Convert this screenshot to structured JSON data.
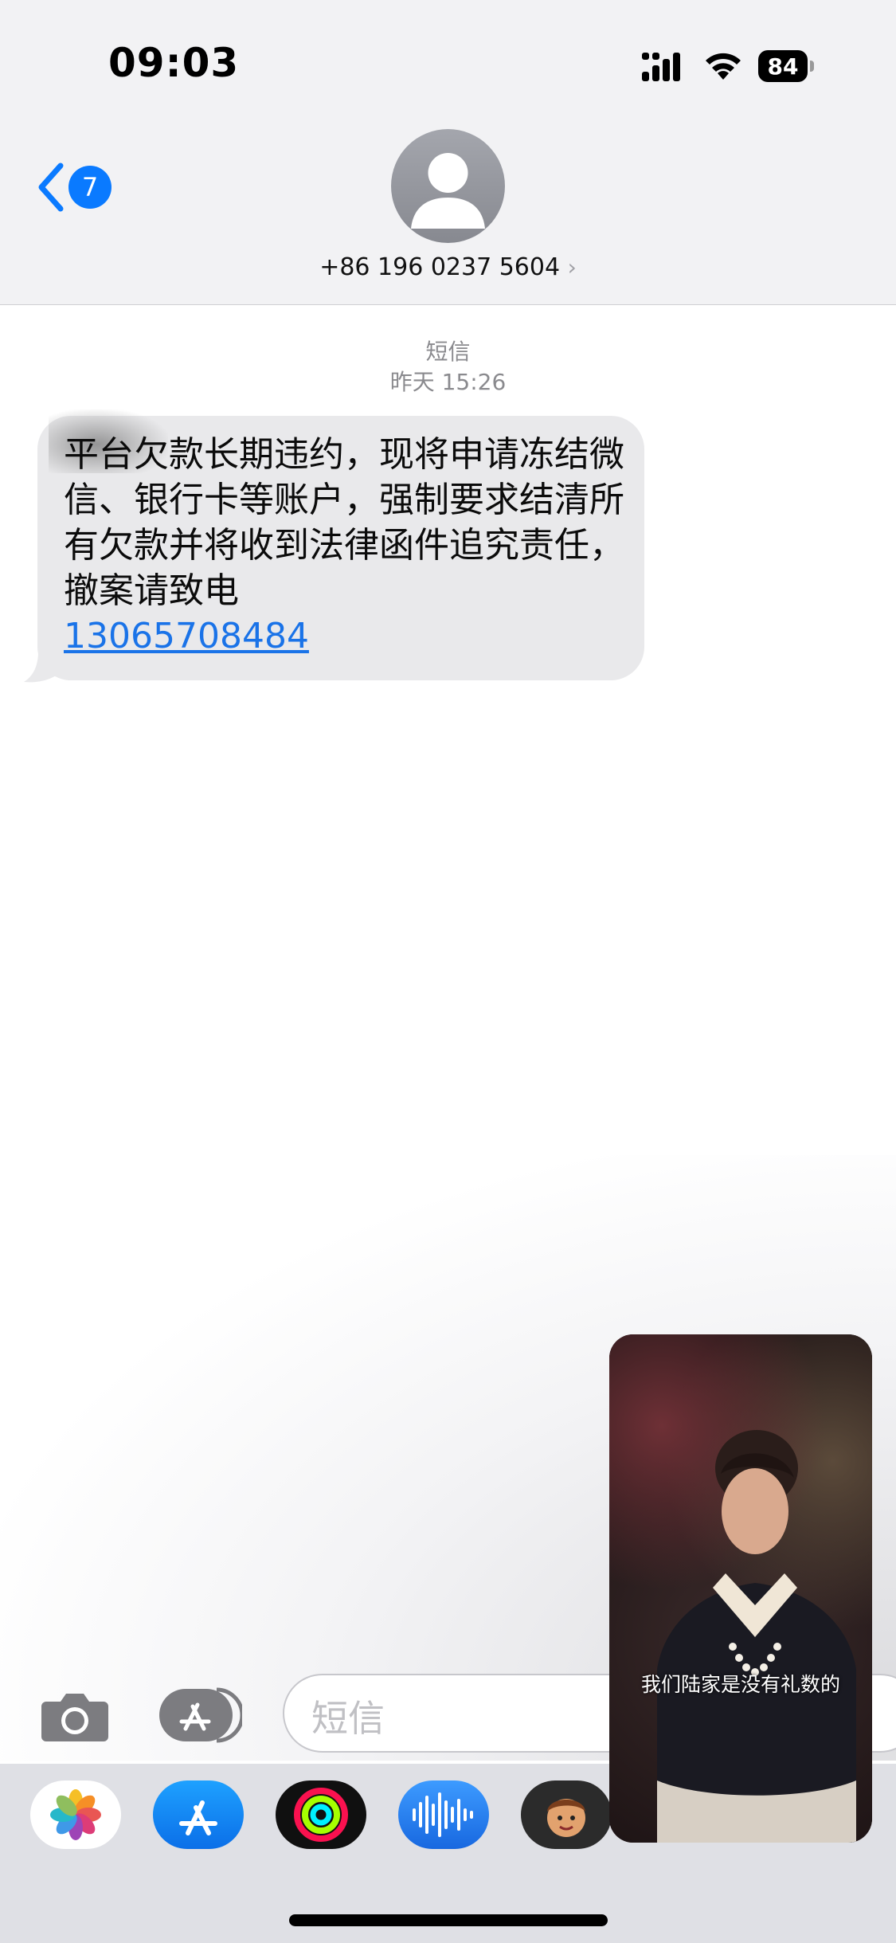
{
  "status_bar": {
    "time": "09:03",
    "battery": "84"
  },
  "header": {
    "back_badge": "7",
    "contact": "+86 196 0237 5604",
    "chevron": "›"
  },
  "conversation": {
    "service_label": "短信",
    "timestamp": "昨天 15:26",
    "messages": [
      {
        "text": "平台欠款长期违约，现将申请冻结微信、银行卡等账户，强制要求结清所有欠款并将收到法律函件追究责任，撤案请致电",
        "link": "13065708484"
      }
    ]
  },
  "compose": {
    "placeholder": "短信"
  },
  "app_drawer": {
    "apps": [
      "photos-icon",
      "app-store-icon",
      "fitness-icon",
      "audio-message-icon",
      "memoji-icon"
    ]
  },
  "pip": {
    "subtitle": "我们陆家是没有礼数的"
  },
  "colors": {
    "accent": "#0a7aff",
    "bubble": "#e9e9eb",
    "header_bg": "#f2f2f4"
  }
}
